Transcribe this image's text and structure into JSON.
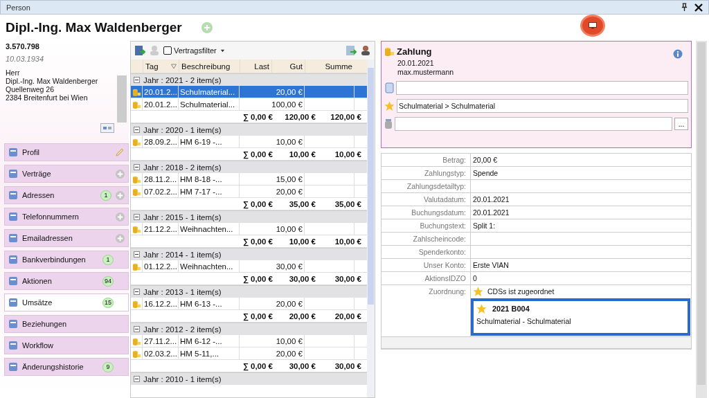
{
  "window": {
    "title": "Person"
  },
  "person": {
    "name": "Dipl.-Ing. Max Waldenberger",
    "number": "3.570.798",
    "birth_date": "10.03.1934",
    "address_lines": [
      "Herr",
      "Dipl.-Ing. Max Waldenberger",
      "Quellenweg 26",
      "2384 Breitenfurt bei Wien"
    ]
  },
  "nav": [
    {
      "label": "Profil",
      "selected": false,
      "editable": true,
      "addable": false
    },
    {
      "label": "Verträge",
      "selected": false,
      "editable": false,
      "addable": true
    },
    {
      "label": "Adressen",
      "selected": false,
      "badge": "1",
      "editable": false,
      "addable": true
    },
    {
      "label": "Telefonnummern",
      "selected": false,
      "editable": false,
      "addable": true
    },
    {
      "label": "Emailadressen",
      "selected": false,
      "editable": false,
      "addable": true
    },
    {
      "label": "Bankverbindungen",
      "selected": false,
      "badge": "1",
      "editable": false,
      "addable": false
    },
    {
      "label": "Aktionen",
      "selected": false,
      "badge": "94",
      "editable": false,
      "addable": false
    },
    {
      "label": "Umsätze",
      "selected": true,
      "badge": "15",
      "editable": false,
      "addable": false
    },
    {
      "label": "Beziehungen",
      "selected": false,
      "editable": false,
      "addable": false
    },
    {
      "label": "Workflow",
      "selected": false,
      "editable": false,
      "addable": false
    },
    {
      "label": "Änderungshistorie",
      "selected": false,
      "badge": "9",
      "editable": false,
      "addable": false
    }
  ],
  "toolbar": {
    "filter_label": "Vertragsfilter",
    "filter_checked": false
  },
  "grid": {
    "columns": [
      {
        "label": "Tag",
        "filtered": true
      },
      {
        "label": "Beschreibung",
        "filtered": false
      },
      {
        "label": "Last",
        "filtered": false
      },
      {
        "label": "Gut",
        "filtered": false
      },
      {
        "label": "Summe",
        "filtered": false
      }
    ],
    "groups": [
      {
        "label": "Jahr : 2021 - 2 item(s)",
        "expanded": true,
        "rows": [
          {
            "date": "20.01.2...",
            "description": "Schulmaterial...",
            "gut": "20,00 €",
            "selected": true
          },
          {
            "date": "20.01.2...",
            "description": "Schulmaterial...",
            "gut": "100,00 €",
            "selected": false
          }
        ],
        "totals": {
          "last": "∑ 0,00 €",
          "gut": "120,00 €",
          "summe": "120,00 €"
        }
      },
      {
        "label": "Jahr : 2020 - 1 item(s)",
        "expanded": true,
        "rows": [
          {
            "date": "28.09.2...",
            "description": "HM 6-19 -...",
            "gut": "10,00 €",
            "selected": false
          }
        ],
        "totals": {
          "last": "∑ 0,00 €",
          "gut": "10,00 €",
          "summe": "10,00 €"
        }
      },
      {
        "label": "Jahr : 2018 - 2 item(s)",
        "expanded": true,
        "rows": [
          {
            "date": "28.11.2...",
            "description": "HM 8-18 -...",
            "gut": "15,00 €",
            "selected": false
          },
          {
            "date": "07.02.2...",
            "description": "HM 7-17 -...",
            "gut": "20,00 €",
            "selected": false
          }
        ],
        "totals": {
          "last": "∑ 0,00 €",
          "gut": "35,00 €",
          "summe": "35,00 €"
        }
      },
      {
        "label": "Jahr : 2015 - 1 item(s)",
        "expanded": true,
        "rows": [
          {
            "date": "21.12.2...",
            "description": "Weihnachten...",
            "gut": "10,00 €",
            "selected": false
          }
        ],
        "totals": {
          "last": "∑ 0,00 €",
          "gut": "10,00 €",
          "summe": "10,00 €"
        }
      },
      {
        "label": "Jahr : 2014 - 1 item(s)",
        "expanded": true,
        "rows": [
          {
            "date": "01.12.2...",
            "description": "Weihnachten...",
            "gut": "30,00 €",
            "selected": false
          }
        ],
        "totals": {
          "last": "∑ 0,00 €",
          "gut": "30,00 €",
          "summe": "30,00 €"
        }
      },
      {
        "label": "Jahr : 2013 - 1 item(s)",
        "expanded": true,
        "rows": [
          {
            "date": "16.12.2...",
            "description": "HM 6-13 -...",
            "gut": "20,00 €",
            "selected": false
          }
        ],
        "totals": {
          "last": "∑ 0,00 €",
          "gut": "20,00 €",
          "summe": "20,00 €"
        }
      },
      {
        "label": "Jahr : 2012 - 2 item(s)",
        "expanded": true,
        "rows": [
          {
            "date": "27.11.2...",
            "description": "HM 6-12 -...",
            "gut": "10,00 €",
            "selected": false
          },
          {
            "date": "02.03.2...",
            "description": "HM 5-11,...",
            "gut": "20,00 €",
            "selected": false
          }
        ],
        "totals": {
          "last": "∑ 0,00 €",
          "gut": "30,00 €",
          "summe": "30,00 €"
        }
      },
      {
        "label": "Jahr : 2010 - 1 item(s)",
        "expanded": true
      }
    ]
  },
  "detail": {
    "title": "Zahlung",
    "date": "20.01.2021",
    "user": "max.mustermann",
    "fields": [
      {
        "kind": "plain"
      },
      {
        "kind": "plain",
        "value": "Schulmaterial > Schulmaterial"
      },
      {
        "kind": "picker",
        "button": "..."
      }
    ],
    "properties": [
      {
        "label": "Betrag:",
        "value": "20,00 €"
      },
      {
        "label": "Zahlungstyp:",
        "value": "Spende"
      },
      {
        "label": "Zahlungsdetailtyp:"
      },
      {
        "label": "Valutadatum:",
        "value": "20.01.2021"
      },
      {
        "label": "Buchungsdatum:",
        "value": "20.01.2021"
      },
      {
        "label": "Buchungstext:",
        "value": "Split 1:"
      },
      {
        "label": "Zahlscheincode:"
      },
      {
        "label": "Spenderkonto:"
      },
      {
        "label": "Unser Konto:",
        "value": "Erste VIAN"
      },
      {
        "label": "AktionsIDZO",
        "value": "0"
      },
      {
        "label": "Zuordnung:",
        "kind": "assignment",
        "value": "CDSs ist zugeordnet",
        "card_title": "2021 B004",
        "card_text": "Schulmaterial - Schulmaterial"
      }
    ]
  }
}
